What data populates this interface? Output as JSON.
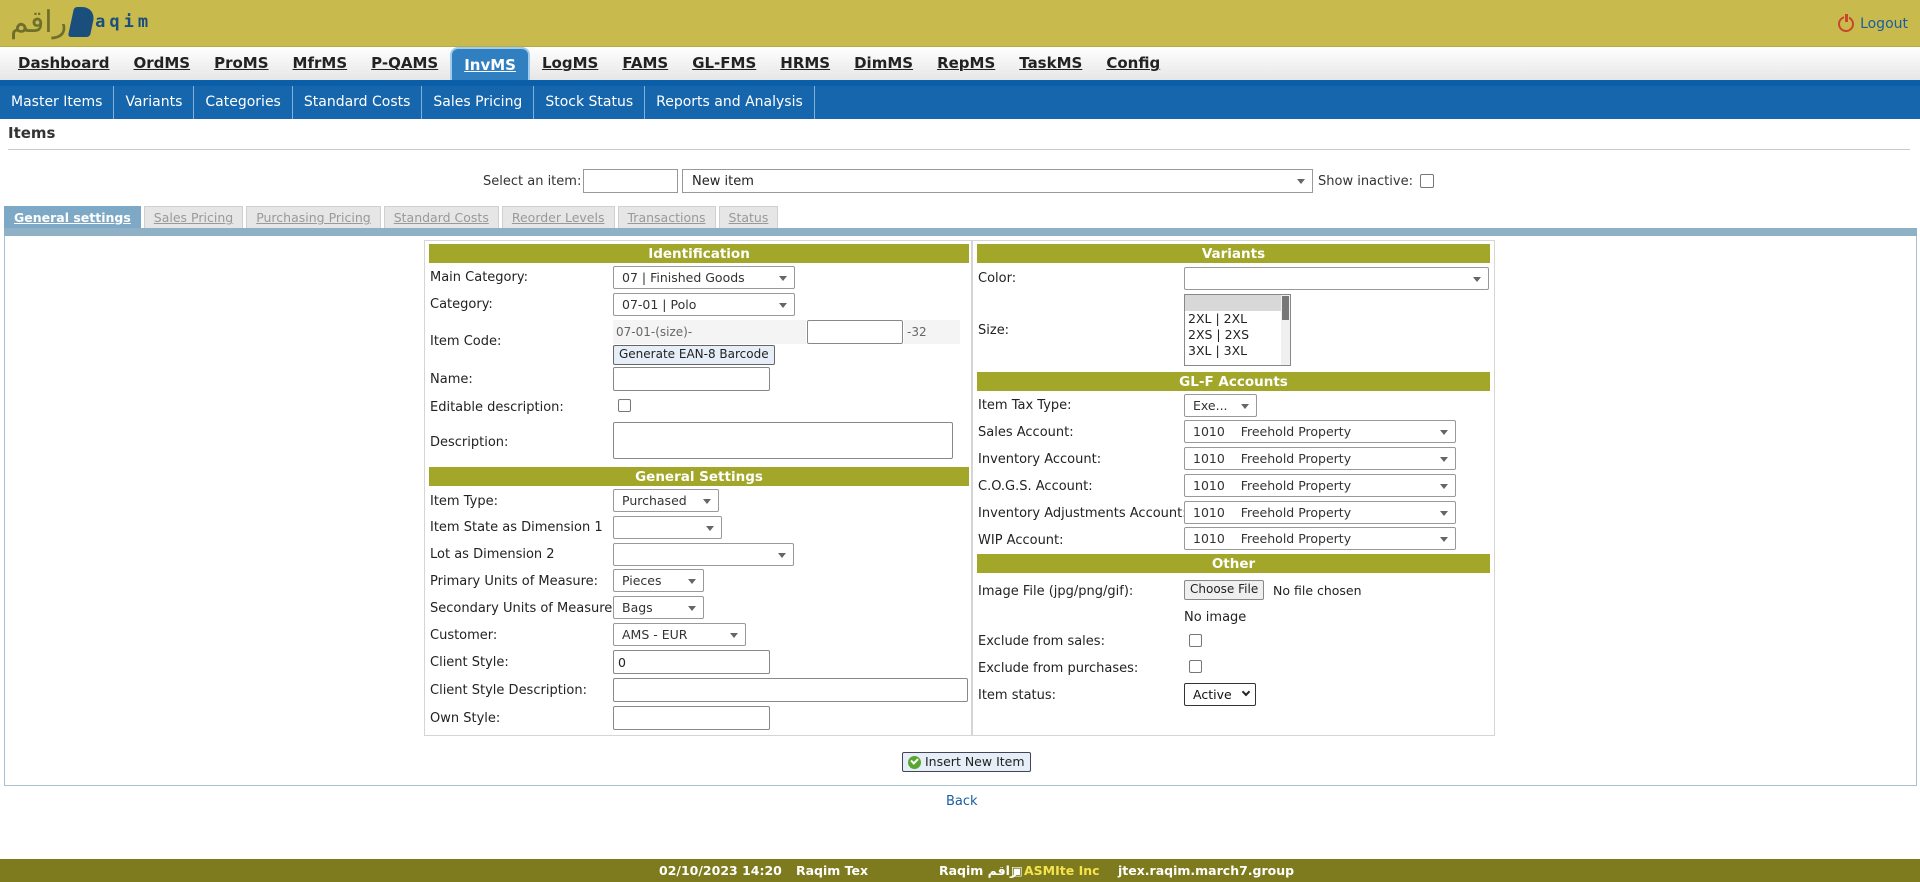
{
  "header": {
    "logo_arabic": "راقم",
    "logo_latin": "aqim",
    "logout": "Logout"
  },
  "mainnav": [
    "Dashboard",
    "OrdMS",
    "ProMS",
    "MfrMS",
    "P-QAMS",
    "InvMS",
    "LogMS",
    "FAMS",
    "GL-FMS",
    "HRMS",
    "DimMS",
    "RepMS",
    "TaskMS",
    "Config"
  ],
  "subnav": [
    "Master Items",
    "Variants",
    "Categories",
    "Standard Costs",
    "Sales Pricing",
    "Stock Status",
    "Reports and Analysis"
  ],
  "page_title": "Items",
  "select": {
    "label": "Select an item:",
    "selected": "New item",
    "show_inactive": "Show inactive:"
  },
  "tabs": [
    "General settings",
    "Sales Pricing",
    "Purchasing Pricing",
    "Standard Costs",
    "Reorder Levels",
    "Transactions",
    "Status"
  ],
  "identification": {
    "title": "Identification",
    "main_category_label": "Main Category:",
    "main_category": "07 | Finished Goods",
    "category_label": "Category:",
    "category": "07-01 | Polo",
    "item_code_label": "Item Code:",
    "code_prefix": "07-01-(size)-",
    "code_suffix": "-32",
    "barcode_button": "Generate EAN-8 Barcode",
    "name_label": "Name:",
    "editable_label": "Editable description:",
    "description_label": "Description:"
  },
  "general": {
    "title": "General Settings",
    "item_type_label": "Item Type:",
    "item_type": "Purchased",
    "state_label": "Item State as Dimension 1",
    "lot_label": "Lot as Dimension 2",
    "primary_uom_label": "Primary Units of Measure:",
    "primary_uom": "Pieces",
    "secondary_uom_label": "Secondary Units of Measure:",
    "secondary_uom": "Bags",
    "customer_label": "Customer:",
    "customer": "AMS - EUR",
    "client_style_label": "Client Style:",
    "client_style": "0",
    "client_style_desc_label": "Client Style Description:",
    "own_style_label": "Own Style:"
  },
  "variants": {
    "title": "Variants",
    "color_label": "Color:",
    "size_label": "Size:",
    "sizes": [
      "",
      "2XL | 2XL",
      "2XS | 2XS",
      "3XL | 3XL"
    ]
  },
  "glf": {
    "title": "GL-F Accounts",
    "tax_label": "Item Tax Type:",
    "tax": "Exe...",
    "sales_label": "Sales Account:",
    "inventory_label": "Inventory Account:",
    "cogs_label": "C.O.G.S. Account:",
    "adj_label": "Inventory Adjustments Account:",
    "wip_label": "WIP Account:",
    "account_code": "1010",
    "account_name": "Freehold Property"
  },
  "other": {
    "title": "Other",
    "image_label": "Image File (jpg/png/gif):",
    "choose_file": "Choose File",
    "no_file": "No file chosen",
    "no_image": "No image",
    "exclude_sales_label": "Exclude from sales:",
    "exclude_purchases_label": "Exclude from purchases:",
    "status_label": "Item status:",
    "status": "Active"
  },
  "insert_button": "Insert New Item",
  "back": "Back",
  "footer": {
    "datetime": "02/10/2023 14:20",
    "company": "Raqim Tex",
    "brand": "Raqim راقم",
    "vendor": "ASMIte Inc",
    "host": "jtex.raqim.march7.group"
  }
}
